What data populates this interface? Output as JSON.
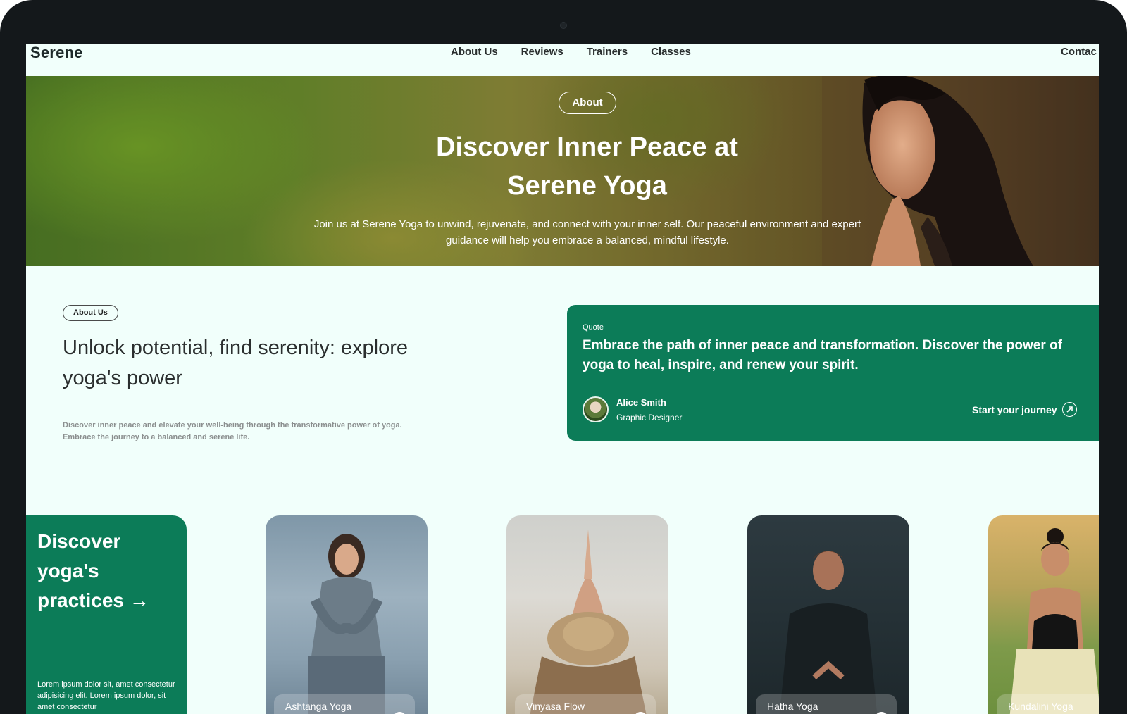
{
  "nav": {
    "brand": "Serene",
    "links": [
      "About Us",
      "Reviews",
      "Trainers",
      "Classes"
    ],
    "contact": "Contac"
  },
  "hero": {
    "pill": "About",
    "title_line1": "Discover Inner Peace at",
    "title_line2": "Serene Yoga",
    "subtitle_line1": "Join us at Serene Yoga to unwind, rejuvenate, and connect with your inner self. Our peaceful environment and expert",
    "subtitle_line2": "guidance will help you embrace a balanced, mindful lifestyle."
  },
  "about": {
    "pill": "About Us",
    "title_line1": "Unlock potential, find serenity: explore",
    "title_line2": "yoga's power",
    "desc_line1": "Discover inner peace and elevate your well-being through the transformative power of yoga.",
    "desc_line2": "Embrace the journey to a balanced and serene life."
  },
  "quote": {
    "label": "Quote",
    "text": "Embrace the path of inner peace and transformation. Discover the power of yoga to heal, inspire, and renew your spirit.",
    "author_name": "Alice Smith",
    "author_role": "Graphic Designer",
    "cta": "Start your journey"
  },
  "practices": {
    "title_line1": "Discover",
    "title_line2": "yoga's",
    "title_line3": "practices",
    "arrow": "→",
    "lorem": "Lorem ipsum dolor sit, amet consectetur adipisicing elit. Lorem ipsum dolor, sit amet consectetur",
    "cards": [
      "Ashtanga Yoga",
      "Vinyasa Flow",
      "Hatha Yoga",
      "Kundalini Yoga"
    ]
  },
  "colors": {
    "accent": "#0c7c58",
    "background": "#f1fffb",
    "device": "#14181b"
  }
}
